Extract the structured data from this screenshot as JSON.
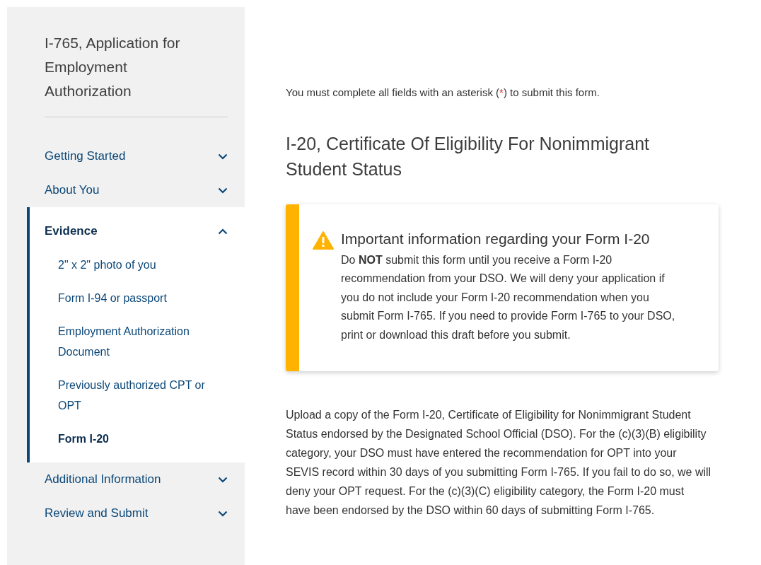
{
  "sidebar": {
    "title": "I-765, Application for Employment Authorization",
    "items": [
      {
        "label": "Getting Started",
        "expanded": false,
        "selected": false
      },
      {
        "label": "About You",
        "expanded": false,
        "selected": false
      },
      {
        "label": "Evidence",
        "expanded": true,
        "selected": true,
        "children": [
          {
            "label": "2\" x 2\" photo of you",
            "selected": false
          },
          {
            "label": "Form I-94 or passport",
            "selected": false
          },
          {
            "label": "Employment Authorization Document",
            "selected": false
          },
          {
            "label": "Previously authorized CPT or OPT",
            "selected": false
          },
          {
            "label": "Form I-20",
            "selected": true
          }
        ]
      },
      {
        "label": "Additional Information",
        "expanded": false,
        "selected": false
      },
      {
        "label": "Review and Submit",
        "expanded": false,
        "selected": false
      }
    ]
  },
  "main": {
    "intro": {
      "before": "You must complete all fields with an asterisk (",
      "required_mark": "*",
      "after": ") to submit this form."
    },
    "heading": "I-20, Certificate Of Eligibility For Nonimmigrant Student Status",
    "alert": {
      "kind": "warning",
      "title": "Important information regarding your Form I-20",
      "body": "Do **NOT** submit this form until you receive a Form I-20 recommendation from your DSO. We will deny your application if you do not include your Form I-20 recommendation when you submit Form I-765. If you need to provide Form I-765 to your DSO, print or download this draft before you submit."
    },
    "paragraph": "Upload a copy of the Form I-20, Certificate of Eligibility for Nonimmigrant Student Status endorsed by the Designated School Official (DSO). For the (c)(3)(B) eligibility category, your DSO must have entered the recommendation for OPT into your SEVIS record within 30 days of you submitting Form I-765. If you fail to do so, we will deny your OPT request. For the (c)(3)(C) eligibility category, the Form I-20 must have been endorsed by the DSO within 60 days of submitting Form I-765."
  }
}
